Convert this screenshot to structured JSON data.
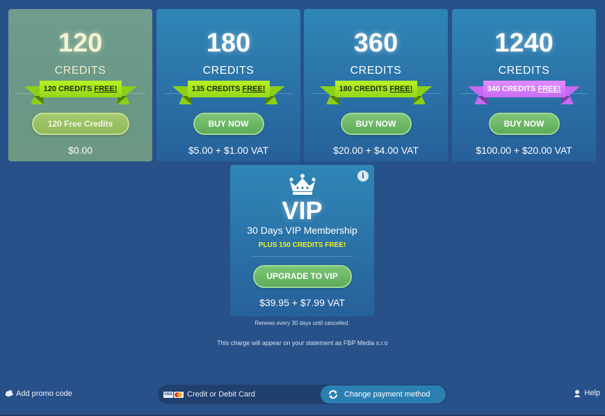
{
  "packages": [
    {
      "amount": "120",
      "unit": "CREDITS",
      "ribbon_text": "120 CREDITS ",
      "ribbon_free": "FREE!",
      "ribbon_color": "green",
      "button_label": "120 Free Credits",
      "price": "$0.00",
      "variant": "free"
    },
    {
      "amount": "180",
      "unit": "CREDITS",
      "ribbon_text": "135 CREDITS ",
      "ribbon_free": "FREE!",
      "ribbon_color": "green",
      "button_label": "BUY NOW",
      "price": "$5.00 + $1.00 VAT",
      "variant": "paid"
    },
    {
      "amount": "360",
      "unit": "CREDITS",
      "ribbon_text": "180 CREDITS ",
      "ribbon_free": "FREE!",
      "ribbon_color": "green",
      "button_label": "BUY NOW",
      "price": "$20.00 + $4.00 VAT",
      "variant": "paid"
    },
    {
      "amount": "1240",
      "unit": "CREDITS",
      "ribbon_text": "340 CREDITS ",
      "ribbon_free": "FREE!",
      "ribbon_color": "purple",
      "button_label": "BUY NOW",
      "price": "$100.00 + $20.00 VAT",
      "variant": "paid"
    }
  ],
  "vip": {
    "info_icon": "info-icon",
    "crown_icon": "crown-icon",
    "title": "VIP",
    "subtitle": "30 Days VIP Membership",
    "bonus": "PLUS 150 CREDITS FREE!",
    "button_label": "UPGRADE TO VIP",
    "price": "$39.95 + $7.99 VAT",
    "renew_note": "Renews every 30 days until cancelled."
  },
  "statement_note": "This charge will appear on your statement as FBP Media s.r.o",
  "bottom_bar": {
    "promo_label": "Add promo code",
    "payment_method_label": "Credit or Debit Card",
    "visa_text": "VISA",
    "change_payment_label": "Change payment method",
    "help_label": "Help"
  },
  "colors": {
    "background": "#28518a",
    "card": "#2a6fa6",
    "free_card": "#6a9886",
    "button_green": "#5eab59",
    "ribbon_green": "#94d61a",
    "ribbon_purple": "#c86cf5",
    "bonus_yellow": "#f3f21d"
  }
}
